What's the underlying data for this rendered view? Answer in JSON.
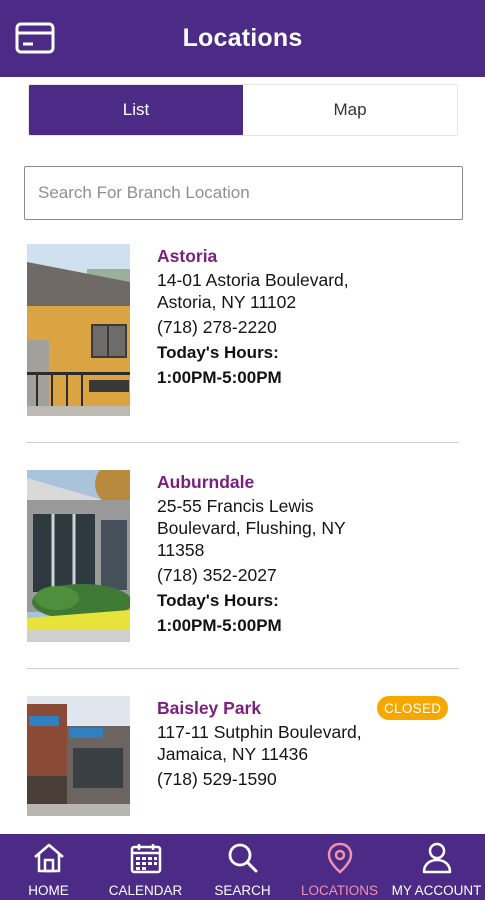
{
  "header": {
    "title": "Locations",
    "card_icon": "card-icon"
  },
  "segment": {
    "list_label": "List",
    "map_label": "Map",
    "selected": "List"
  },
  "search": {
    "placeholder": "Search For Branch Location",
    "value": ""
  },
  "locations": [
    {
      "name": "Astoria",
      "address": "14-01 Astoria Boulevard, Astoria, NY 11102",
      "phone": "(718) 278-2220",
      "hours_label": "Today's Hours:",
      "hours": "1:00PM-5:00PM"
    },
    {
      "name": "Auburndale",
      "address": "25-55 Francis Lewis Boulevard, Flushing, NY 11358",
      "phone": "(718) 352-2027",
      "hours_label": "Today's Hours:",
      "hours": "1:00PM-5:00PM"
    },
    {
      "name": "Baisley Park",
      "address": "117-11 Sutphin Boulevard, Jamaica, NY 11436",
      "phone": "(718) 529-1590",
      "badge": "CLOSED"
    }
  ],
  "tabs": [
    {
      "label": "HOME",
      "icon": "home-icon"
    },
    {
      "label": "CALENDAR",
      "icon": "calendar-icon"
    },
    {
      "label": "SEARCH",
      "icon": "search-icon"
    },
    {
      "label": "LOCATIONS",
      "icon": "location-pin-icon",
      "active": true
    },
    {
      "label": "MY ACCOUNT",
      "icon": "person-icon"
    }
  ],
  "colors": {
    "brand": "#4b2b86",
    "name": "#7a1f7e",
    "closed": "#f6a800",
    "active_tab": "#f48fb1"
  }
}
